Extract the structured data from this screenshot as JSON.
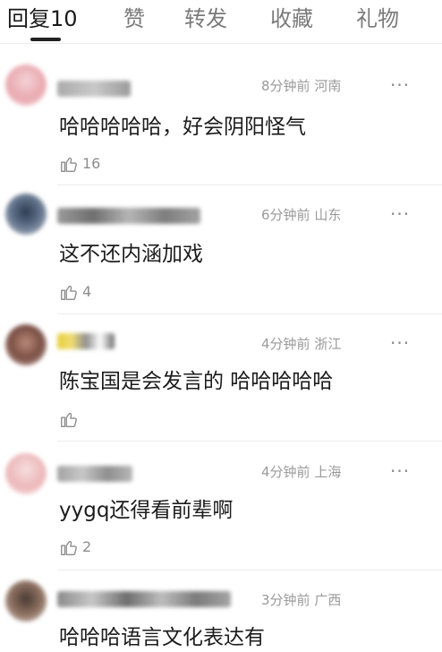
{
  "tabs": [
    {
      "label": "回复",
      "count": "10"
    },
    {
      "label": "赞"
    },
    {
      "label": "转发"
    },
    {
      "label": "收藏"
    },
    {
      "label": "礼物"
    }
  ],
  "comments": [
    {
      "time": "8分钟前",
      "location": "河南",
      "text": "哈哈哈哈哈，好会阴阳怪气",
      "likes": "16"
    },
    {
      "time": "6分钟前",
      "location": "山东",
      "text": "这不还内涵加戏",
      "likes": "4"
    },
    {
      "time": "4分钟前",
      "location": "浙江",
      "text": "陈宝国是会发言的 哈哈哈哈哈",
      "likes": ""
    },
    {
      "time": "4分钟前",
      "location": "上海",
      "text": "yygq还得看前辈啊",
      "likes": "2"
    },
    {
      "time": "3分钟前",
      "location": "广西",
      "text": "哈哈哈语言文化表达有",
      "likes": ""
    }
  ],
  "more_label": "···",
  "colors": {
    "text": "#1c1c1c",
    "meta": "#9a9a9a",
    "divider": "#ececec"
  }
}
